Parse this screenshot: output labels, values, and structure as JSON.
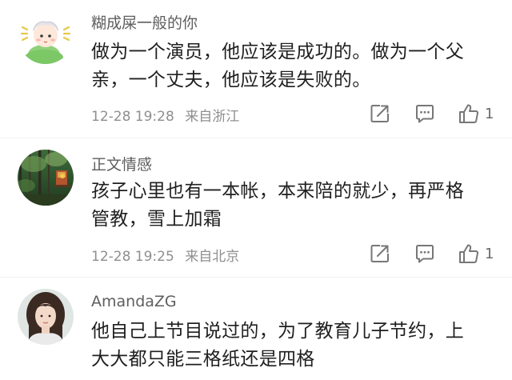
{
  "comments": [
    {
      "username": "糊成屎一般的你",
      "lines": [
        "做为一个演员，他应该是成功的。做为一个父",
        "亲，一个丈夫，他应该是失败的。"
      ],
      "time": "12-28 19:28",
      "location": "来自浙江",
      "likes": "1",
      "avatar_icon": "cartoon-boy-avatar"
    },
    {
      "username": "正文情感",
      "lines": [
        "孩子心里也有一本帐，本来陪的就少，再严格",
        "管教，雪上加霜"
      ],
      "time": "12-28 19:25",
      "location": "来自北京",
      "likes": "1",
      "avatar_icon": "forest-photo-avatar"
    },
    {
      "username": "AmandaZG",
      "lines": [
        "他自己上节目说过的，为了教育儿子节约，上",
        "大大都只能三格纸还是四格"
      ],
      "avatar_icon": "woman-portrait-avatar"
    }
  ],
  "colors": {
    "text": "#1f1f1f",
    "username": "#5e5e5e",
    "meta": "#8f8f8f",
    "icon": "#777777"
  }
}
